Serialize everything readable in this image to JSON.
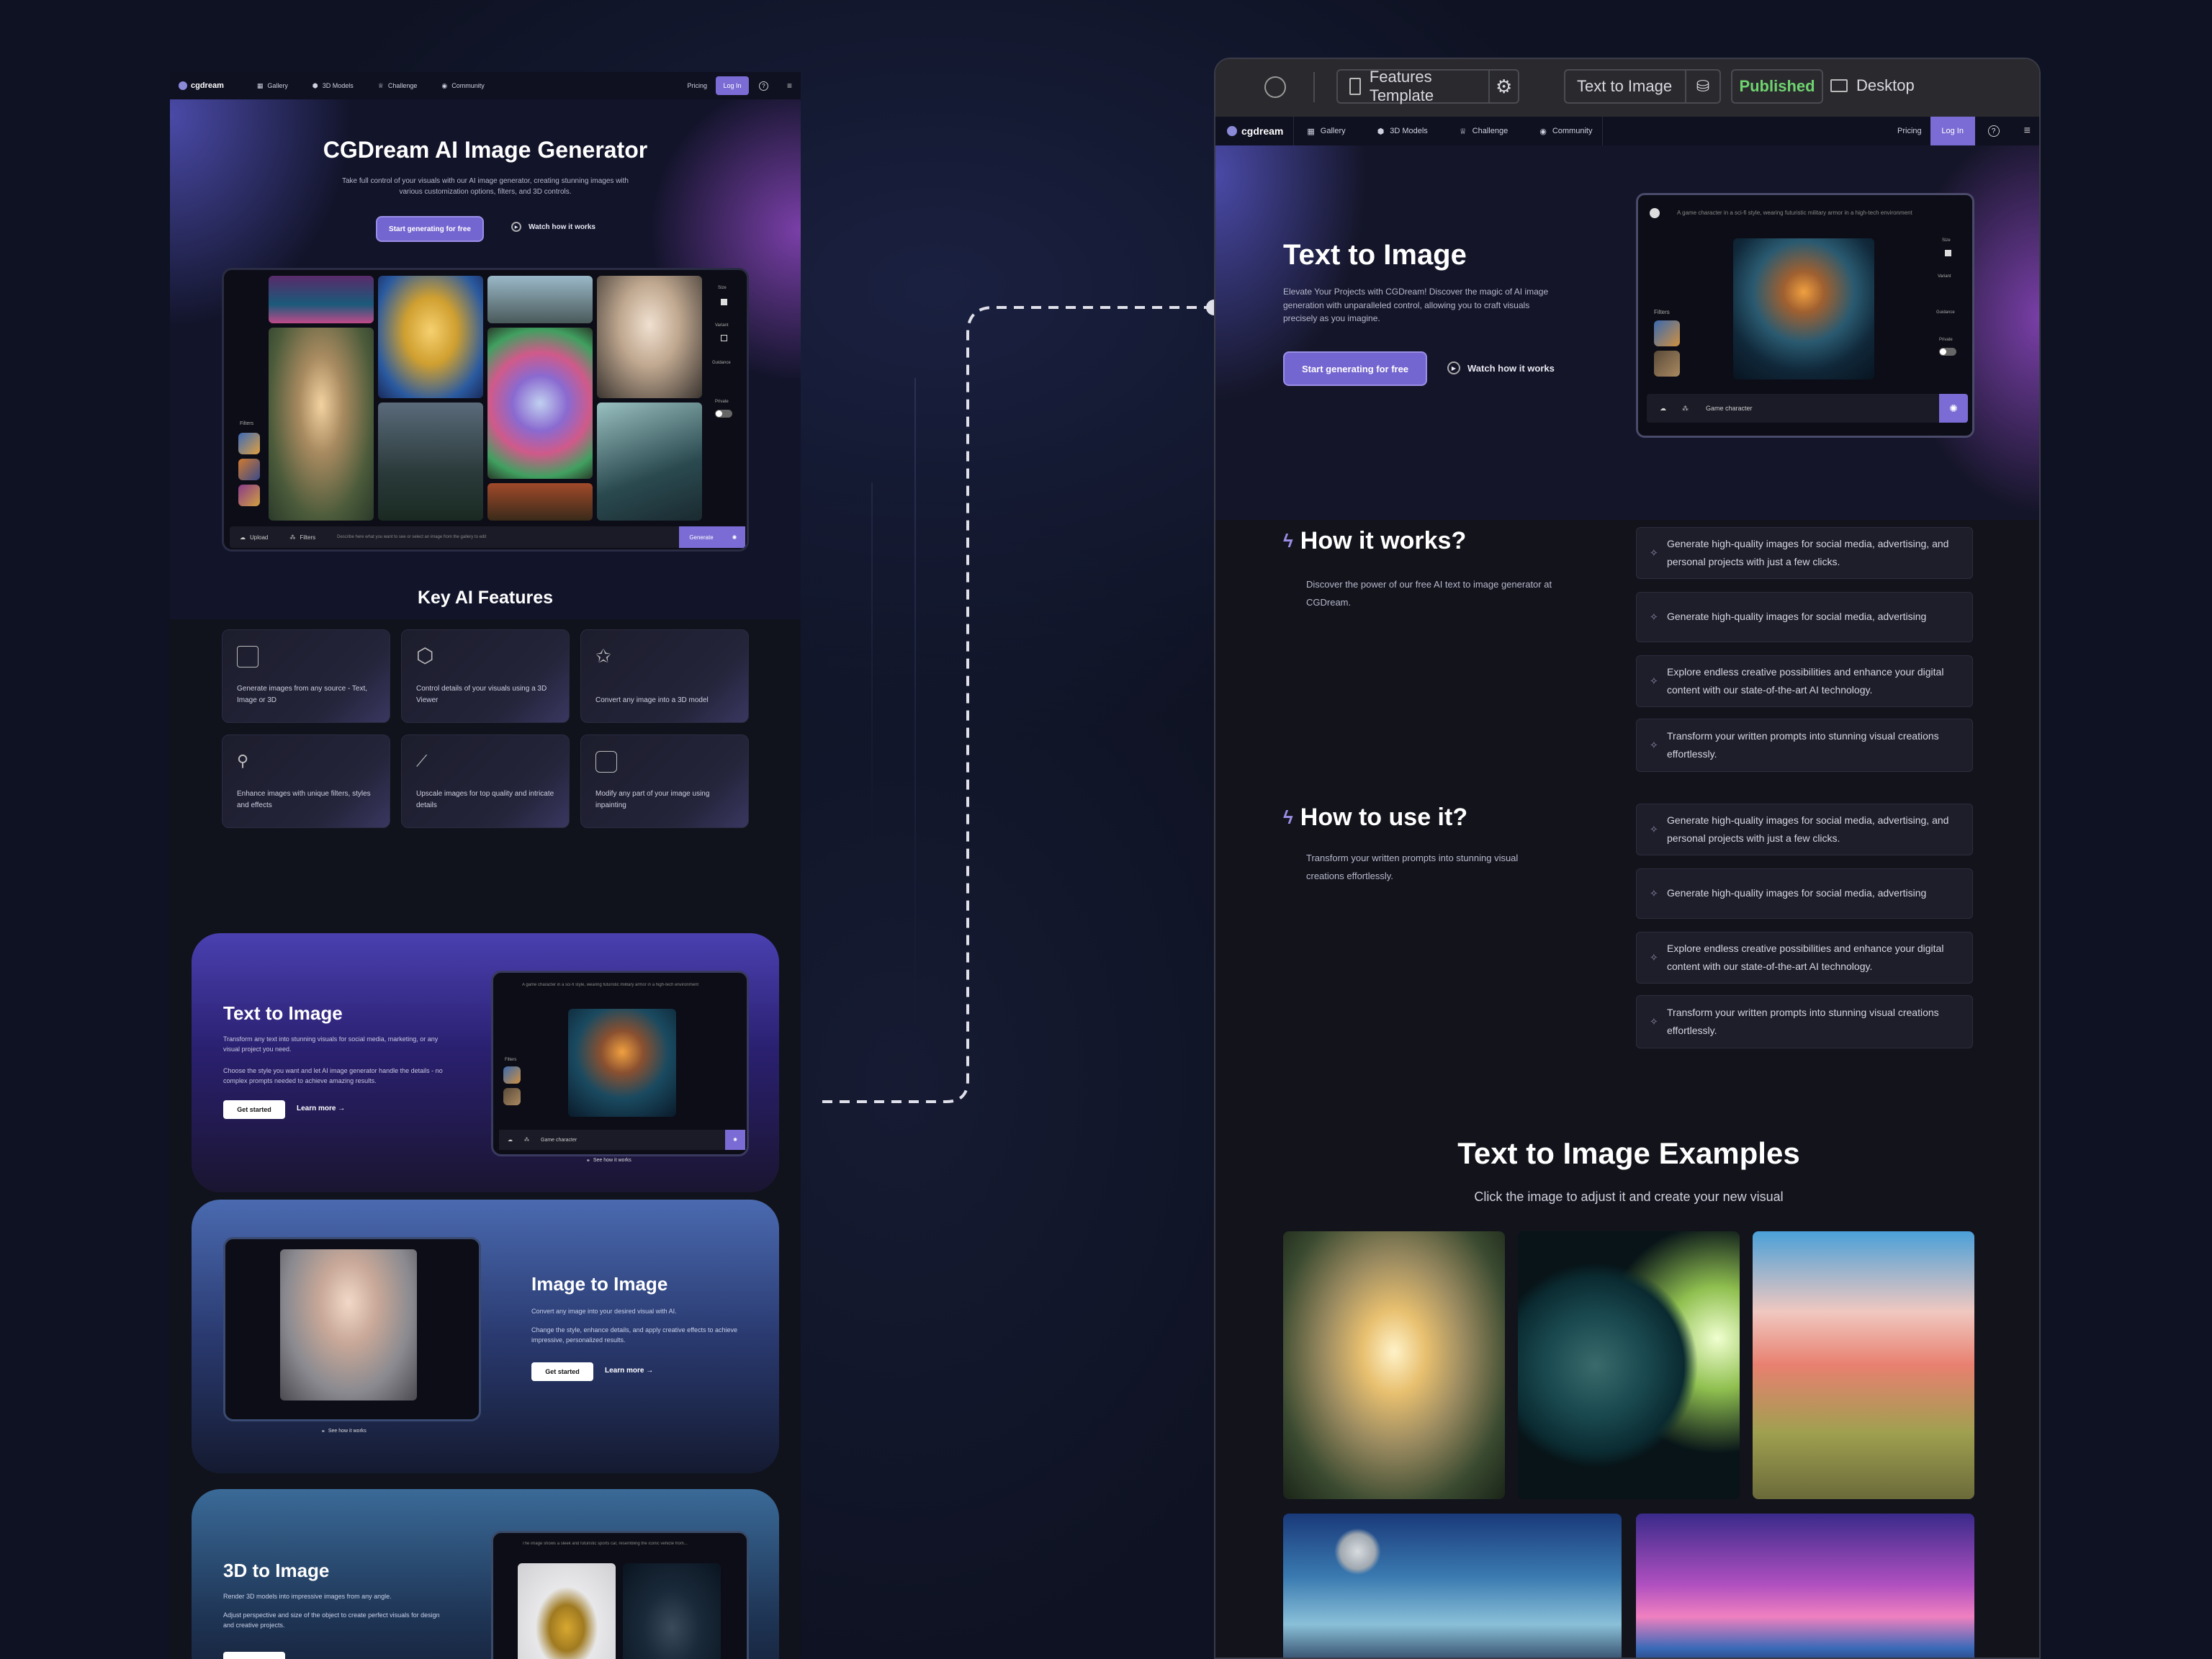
{
  "left_page": {
    "nav": {
      "logo": "cgdream",
      "items": [
        "Gallery",
        "3D Models",
        "Challenge",
        "Community"
      ],
      "pricing": "Pricing",
      "login": "Log In"
    },
    "hero": {
      "title": "CGDream AI Image Generator",
      "subtitle": "Take full control of your visuals with our AI image generator, creating stunning images with various customization options, filters, and 3D controls.",
      "cta": "Start generating for free",
      "watch": "Watch how it works"
    },
    "preview": {
      "filters_label": "Filters",
      "upload": "Upload",
      "filters": "Filters",
      "prompt_placeholder": "Describe here what you want to see or select an image from the gallery to edit",
      "generate": "Generate",
      "side": [
        "Size",
        "Variant",
        "Guidance",
        "Private"
      ]
    },
    "features": {
      "title": "Key AI Features",
      "cards": [
        "Generate images from any source - Text, Image or 3D",
        "Control details of your visuals using a 3D Viewer",
        "Convert any image into a 3D model",
        "Enhance images with unique filters, styles and effects",
        "Upscale images for top quality and intricate details",
        "Modify any part of your image using inpainting"
      ]
    },
    "text_to_image": {
      "title": "Text to Image",
      "p1": "Transform any text into stunning visuals for social media, marketing, or any visual project you need.",
      "p2": "Choose the style you want and let AI image generator handle the details - no complex prompts needed to achieve amazing results.",
      "get_started": "Get started",
      "learn_more": "Learn more",
      "prompt": "A game character in a sci-fi style, wearing futuristic military armor in a high-tech environment",
      "input": "Game character",
      "see_how": "See how it works",
      "filters_label": "Filters"
    },
    "image_to_image": {
      "title": "Image to Image",
      "p1": "Convert any image into your desired visual with AI.",
      "p2": "Change the style, enhance details, and apply creative effects to achieve impressive, personalized results.",
      "get_started": "Get started",
      "learn_more": "Learn more",
      "see_how": "See how it works"
    },
    "three_d_to_image": {
      "title": "3D to Image",
      "p1": "Render 3D models into impressive images from any angle.",
      "p2": "Adjust perspective and size of the object to create perfect visuals for design and creative projects.",
      "prompt": "The image shows a sleek and futuristic sports car, resembling the iconic vehicle from..."
    }
  },
  "right_page": {
    "toolbar": {
      "template": "Features Template",
      "page": "Text to Image",
      "status": "Published",
      "device": "Desktop"
    },
    "nav": {
      "logo": "cgdream",
      "items": [
        "Gallery",
        "3D Models",
        "Challenge",
        "Community"
      ],
      "pricing": "Pricing",
      "login": "Log In"
    },
    "hero": {
      "title": "Text to Image",
      "subtitle": "Elevate Your Projects with CGDream! Discover the magic of AI image generation with unparalleled control, allowing you to craft visuals precisely as you imagine.",
      "cta": "Start generating for free",
      "watch": "Watch how it works",
      "prompt": "A game character in a sci-fi style, wearing futuristic military armor in a high-tech environment",
      "input": "Game character",
      "filters_label": "Filters",
      "side": [
        "Size",
        "Variant",
        "Guidance",
        "Private"
      ]
    },
    "how_it_works": {
      "title": "How it works?",
      "desc": "Discover the power of our free AI text to image generator at CGDream.",
      "items": [
        "Generate high-quality images for social media, advertising, and personal projects with just a few clicks.",
        "Generate high-quality images for social media, advertising",
        "Explore endless creative possibilities and enhance your digital content with our state-of-the-art AI technology.",
        "Transform your written prompts into stunning visual creations effortlessly."
      ]
    },
    "how_to_use": {
      "title": "How to use it?",
      "desc": "Transform your written prompts into stunning visual creations effortlessly.",
      "items": [
        "Generate high-quality images for social media, advertising, and personal projects with just a few clicks.",
        "Generate high-quality images for social media, advertising",
        "Explore endless creative possibilities and enhance your digital content with our state-of-the-art AI technology.",
        "Transform your written prompts into stunning visual creations effortlessly."
      ]
    },
    "examples": {
      "title": "Text to Image Examples",
      "subtitle": "Click the image to adjust it and create your new visual"
    }
  },
  "colors": {
    "accent": "#7466d0",
    "published": "#6fd36f",
    "background": "#0e1222"
  }
}
